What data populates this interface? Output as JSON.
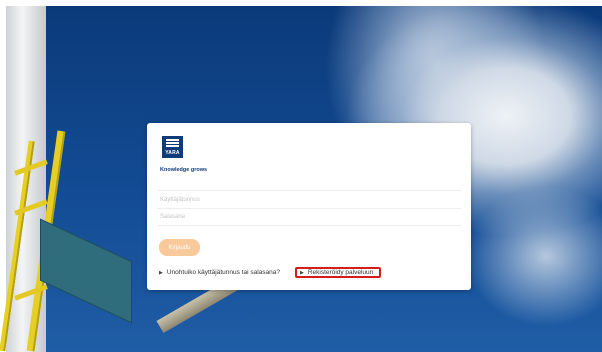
{
  "login": {
    "logo_text": "YARA",
    "tagline": "Knowledge grows",
    "username_placeholder": "Käyttäjätunnus",
    "password_placeholder": "Salasana",
    "login_button": "Kirjaudu",
    "forgot_link": "Unohtuiko käyttäjätunnus tai salasana?",
    "register_link": "Rekisteröidy palveluun",
    "link_icon": "caret-right-icon"
  },
  "colors": {
    "brand": "#103c7c",
    "button": "#f7c99b",
    "highlight": "#d61d1d"
  }
}
